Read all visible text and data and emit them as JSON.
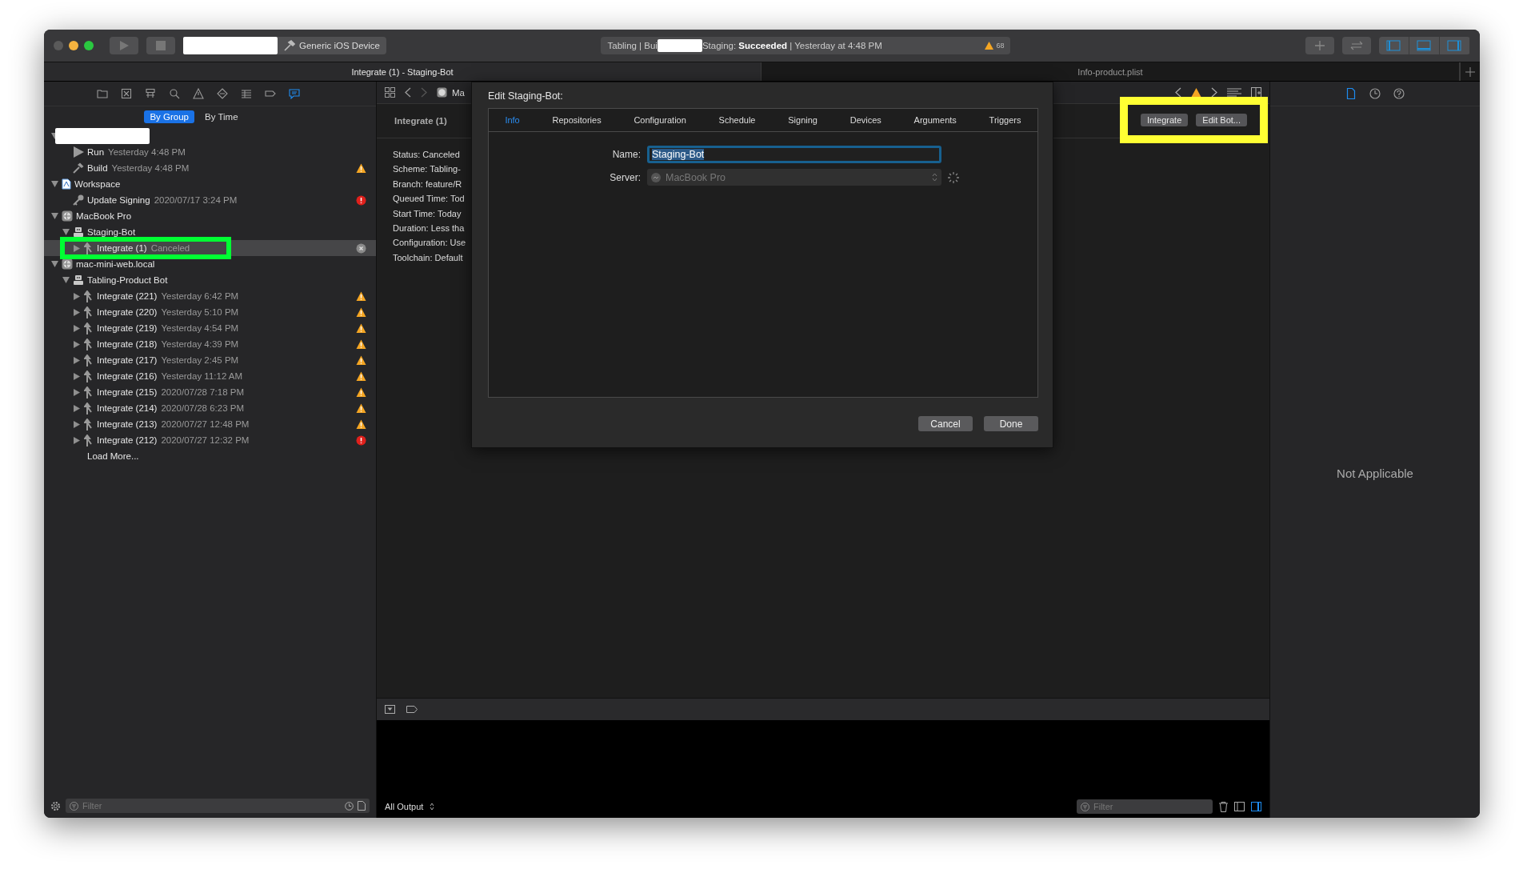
{
  "toolbar": {
    "scheme": "Generic iOS Device",
    "activity_start": "Tabling | Bui",
    "activity_end": "Staging: **Succeeded** | Yesterday at 4:48 PM",
    "warning_count": "68",
    "panels": [
      {
        "kind": "navigator",
        "on": true
      },
      {
        "kind": "debug",
        "on": true
      },
      {
        "kind": "inspector",
        "on": true
      }
    ]
  },
  "tabs": [
    {
      "label": "Integrate (1) - Staging-Bot",
      "selected": true
    },
    {
      "label": "Info-product.plist",
      "selected": false
    }
  ],
  "navigator_tabs": [
    {
      "kind": "folder",
      "selected": false
    },
    {
      "kind": "source",
      "selected": false
    },
    {
      "kind": "hierarchy",
      "selected": false
    },
    {
      "kind": "search",
      "selected": false
    },
    {
      "kind": "issue",
      "selected": false
    },
    {
      "kind": "test",
      "selected": false
    },
    {
      "kind": "debug",
      "selected": false
    },
    {
      "kind": "breakpoint",
      "selected": false
    },
    {
      "kind": "report",
      "selected": true
    }
  ],
  "navigator": {
    "segments": [
      {
        "label": "By Group",
        "selected": true
      },
      {
        "label": "By Time",
        "selected": false
      }
    ],
    "tree": [
      {
        "kind": "redacted",
        "expanded": true,
        "selected": false,
        "children": [
          {
            "kind": "run",
            "name": "Run",
            "detail": "Yesterday 4:48 PM",
            "selected": false
          },
          {
            "kind": "build",
            "name": "Build",
            "detail": "Yesterday 4:48 PM",
            "status": {
              "kind": "warning"
            },
            "selected": false
          }
        ]
      },
      {
        "kind": "workspace",
        "name": "Workspace",
        "expanded": true,
        "selected": false,
        "children": [
          {
            "kind": "signing",
            "name": "Update Signing",
            "detail": "2020/07/17 3:24 PM",
            "status": {
              "kind": "error"
            },
            "selected": false
          }
        ]
      },
      {
        "kind": "server",
        "name": "MacBook Pro",
        "expanded": true,
        "selected": false,
        "children": [
          {
            "kind": "bot",
            "name": "Staging-Bot",
            "expanded": true,
            "selected": false,
            "children": [
              {
                "kind": "integration",
                "name": "Integrate (1)",
                "detail": "Canceled",
                "status": {
                  "kind": "canceled"
                },
                "expanded": false,
                "selected": true,
                "highlight": {
                  "color": "#00ff33"
                }
              }
            ]
          }
        ]
      },
      {
        "kind": "server",
        "name": "mac-mini-web.local",
        "expanded": true,
        "selected": false,
        "children": [
          {
            "kind": "bot",
            "name": "Tabling-Product Bot",
            "expanded": true,
            "selected": false,
            "children": [
              {
                "kind": "integration",
                "name": "Integrate (221)",
                "detail": "Yesterday 6:42 PM",
                "status": {
                  "kind": "warning"
                },
                "expanded": false,
                "selected": false
              },
              {
                "kind": "integration",
                "name": "Integrate (220)",
                "detail": "Yesterday 5:10 PM",
                "status": {
                  "kind": "warning"
                },
                "expanded": false,
                "selected": false
              },
              {
                "kind": "integration",
                "name": "Integrate (219)",
                "detail": "Yesterday 4:54 PM",
                "status": {
                  "kind": "warning"
                },
                "expanded": false,
                "selected": false
              },
              {
                "kind": "integration",
                "name": "Integrate (218)",
                "detail": "Yesterday 4:39 PM",
                "status": {
                  "kind": "warning"
                },
                "expanded": false,
                "selected": false
              },
              {
                "kind": "integration",
                "name": "Integrate (217)",
                "detail": "Yesterday 2:45 PM",
                "status": {
                  "kind": "warning"
                },
                "expanded": false,
                "selected": false
              },
              {
                "kind": "integration",
                "name": "Integrate (216)",
                "detail": "Yesterday 11:12 AM",
                "status": {
                  "kind": "warning"
                },
                "expanded": false,
                "selected": false
              },
              {
                "kind": "integration",
                "name": "Integrate (215)",
                "detail": "2020/07/28 7:18 PM",
                "status": {
                  "kind": "warning"
                },
                "expanded": false,
                "selected": false
              },
              {
                "kind": "integration",
                "name": "Integrate (214)",
                "detail": "2020/07/28 6:23 PM",
                "status": {
                  "kind": "warning"
                },
                "expanded": false,
                "selected": false
              },
              {
                "kind": "integration",
                "name": "Integrate (213)",
                "detail": "2020/07/27 12:48 PM",
                "status": {
                  "kind": "warning"
                },
                "expanded": false,
                "selected": false
              },
              {
                "kind": "integration",
                "name": "Integrate (212)",
                "detail": "2020/07/27 12:32 PM",
                "status": {
                  "kind": "error"
                },
                "expanded": false,
                "selected": false
              },
              {
                "kind": "more",
                "name": "Load More...",
                "selected": false
              }
            ]
          }
        ]
      }
    ],
    "filter_placeholder": "Filter"
  },
  "editor": {
    "jump_bar": "Ma",
    "report_title": "Integrate (1)",
    "details": [
      "Status: Canceled",
      "Scheme: Tabling-",
      "Branch: feature/R",
      "Queued Time: Tod",
      "Start Time: Today",
      "Duration: Less tha",
      "Configuration: Use",
      "Toolchain: Default"
    ],
    "actions": [
      "Integrate",
      "Edit Bot..."
    ],
    "actions_highlight": {
      "color": "#ffff33"
    }
  },
  "dialog": {
    "title": "Edit Staging-Bot:",
    "tabs": [
      {
        "label": "Info",
        "selected": true
      },
      {
        "label": "Repositories",
        "selected": false
      },
      {
        "label": "Configuration",
        "selected": false
      },
      {
        "label": "Schedule",
        "selected": false
      },
      {
        "label": "Signing",
        "selected": false
      },
      {
        "label": "Devices",
        "selected": false
      },
      {
        "label": "Arguments",
        "selected": false
      },
      {
        "label": "Triggers",
        "selected": false
      }
    ],
    "name_label": "Name:",
    "name_value": "Staging-Bot",
    "server_label": "Server:",
    "server_value": "MacBook Pro",
    "server_disabled": true,
    "buttons": [
      "Cancel",
      "Done"
    ]
  },
  "inspector_tabs": [
    {
      "kind": "file",
      "selected": true
    },
    {
      "kind": "history",
      "selected": false
    },
    {
      "kind": "help",
      "selected": false
    }
  ],
  "inspector": {
    "message": "Not Applicable"
  },
  "console": {
    "output_menu": "All Output",
    "filter_placeholder": "Filter"
  }
}
